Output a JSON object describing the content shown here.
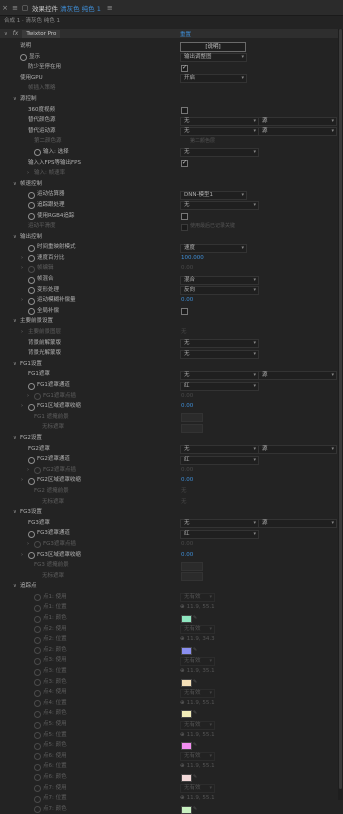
{
  "header": {
    "menu_icon": "hamburger-icon",
    "lock_icon": "lock-icon",
    "title_prefix": "效果控件",
    "title_accent": "清灰色 纯色 1",
    "title_suffix": "≡",
    "panel_menu": "≡"
  },
  "breadcrumb": "合成 1 · 清灰色 纯色 1",
  "effect": {
    "fx_label": "fx",
    "name": "Twixtor Pro",
    "reset": "重置"
  },
  "rows": [
    {
      "indent": 1,
      "label": "说明",
      "control": "button",
      "value": "[说明]"
    },
    {
      "indent": 1,
      "label": "显示",
      "control": "dropdown",
      "value": "输出调整图",
      "stopwatch": true,
      "dd_width": 62
    },
    {
      "indent": 2,
      "label": "防少至停在用",
      "control": "checkbox",
      "checked": true
    },
    {
      "indent": 1,
      "label": "使用GPU",
      "control": "dropdown",
      "value": "开启",
      "dd_width": 62
    },
    {
      "indent": 2,
      "label": "帧插入策略",
      "control": "none",
      "dim": true
    },
    {
      "indent": 1,
      "label": "源控制",
      "control": "none",
      "twirl": "open"
    },
    {
      "indent": 2,
      "label": "360度视频",
      "control": "checkbox",
      "checked": false
    },
    {
      "indent": 2,
      "label": "替代颜色源",
      "control": "dropdown2",
      "value": "无",
      "value2": "源",
      "dd_width": 74
    },
    {
      "indent": 2,
      "label": "替代运动源",
      "control": "dropdown2",
      "value": "无",
      "value2": "源",
      "dd_width": 74
    },
    {
      "indent": 3,
      "label": "第二颜色源",
      "control": "none",
      "dim": true,
      "right_label": "第二颜色层"
    },
    {
      "indent": 3,
      "label": "输入: 选择",
      "control": "dropdown",
      "value": "无",
      "stopwatch": true,
      "dd_width": 74
    },
    {
      "indent": 2,
      "label": "输入入FPS等输出FPS",
      "control": "checkbox",
      "checked": true
    },
    {
      "indent": 3,
      "label": "输入: 帧速率",
      "control": "none",
      "dim": true,
      "twirl": "closed"
    },
    {
      "indent": 1,
      "label": "帧速控制",
      "control": "none",
      "twirl": "open"
    },
    {
      "indent": 2,
      "label": "运动估算器",
      "control": "dropdown",
      "value": "DNN-模型1",
      "stopwatch": true,
      "dd_width": 62
    },
    {
      "indent": 2,
      "label": "追踪跟处理",
      "control": "dropdown",
      "value": "无",
      "stopwatch": true,
      "dd_width": 74
    },
    {
      "indent": 2,
      "label": "使用RGB4追踪",
      "control": "checkbox",
      "checked": false,
      "stopwatch": true
    },
    {
      "indent": 2,
      "label": "运动平滑度",
      "control": "checkbox_label",
      "checked": false,
      "dim": true,
      "right_label": "使用最后已记录关键"
    },
    {
      "indent": 1,
      "label": "输出控制",
      "control": "none",
      "twirl": "open"
    },
    {
      "indent": 2,
      "label": "时间重映射模式",
      "control": "dropdown",
      "value": "速度",
      "stopwatch": true,
      "dd_width": 62
    },
    {
      "indent": 2,
      "label": "速度百分比",
      "control": "value",
      "value": "100.000",
      "stopwatch": true,
      "twirl": "closed"
    },
    {
      "indent": 2,
      "label": "帧编辑",
      "control": "value",
      "value": "0.00",
      "stopwatch": true,
      "twirl": "closed",
      "dim": true
    },
    {
      "indent": 2,
      "label": "帧混合",
      "control": "dropdown",
      "value": "混合",
      "stopwatch": true,
      "dd_width": 74
    },
    {
      "indent": 2,
      "label": "变形处理",
      "control": "dropdown",
      "value": "反向",
      "stopwatch": true,
      "dd_width": 74
    },
    {
      "indent": 2,
      "label": "运动模糊补偿量",
      "control": "value",
      "value": "0.00",
      "stopwatch": true,
      "twirl": "closed"
    },
    {
      "indent": 2,
      "label": "全局补偿",
      "control": "checkbox",
      "checked": false,
      "stopwatch": true
    },
    {
      "indent": 1,
      "label": "主要前景设置",
      "control": "none",
      "twirl": "open"
    },
    {
      "indent": 2,
      "label": "主要前景图层",
      "control": "value_dim",
      "value": "无",
      "twirl": "closed",
      "dim": true
    },
    {
      "indent": 2,
      "label": "背景前解蒙版",
      "control": "dropdown",
      "value": "无",
      "dd_width": 74
    },
    {
      "indent": 2,
      "label": "背景光解蒙版",
      "control": "dropdown",
      "value": "无",
      "dd_width": 74
    },
    {
      "indent": 1,
      "label": "FG1设置",
      "control": "none",
      "twirl": "open"
    },
    {
      "indent": 2,
      "label": "FG1遮罩",
      "control": "dropdown2",
      "value": "无",
      "value2": "源",
      "dd_width": 74
    },
    {
      "indent": 2,
      "label": "FG1遮罩通道",
      "control": "dropdown",
      "value": "红",
      "stopwatch": true,
      "dd_width": 74
    },
    {
      "indent": 3,
      "label": "FG1遮罩点插",
      "control": "value_dim",
      "value": "0.00",
      "twirl": "closed",
      "dim": true,
      "stopwatch": true
    },
    {
      "indent": 2,
      "label": "FG1区域遮罩收缩",
      "control": "value",
      "value": "0.00",
      "stopwatch": true,
      "twirl": "closed"
    },
    {
      "indent": 3,
      "label": "FG1 遮掩前景",
      "control": "box",
      "dim": true
    },
    {
      "indent": 4,
      "label": "无标遮罩",
      "control": "box",
      "dim": true
    },
    {
      "indent": 1,
      "label": "FG2设置",
      "control": "none",
      "twirl": "open"
    },
    {
      "indent": 2,
      "label": "FG2遮罩",
      "control": "dropdown2",
      "value": "无",
      "value2": "源",
      "dd_width": 74
    },
    {
      "indent": 2,
      "label": "FG2遮罩通道",
      "control": "dropdown",
      "value": "红",
      "stopwatch": true,
      "dd_width": 74
    },
    {
      "indent": 3,
      "label": "FG2遮罩点插",
      "control": "value_dim",
      "value": "0.00",
      "twirl": "closed",
      "dim": true,
      "stopwatch": true
    },
    {
      "indent": 2,
      "label": "FG2区域遮罩收缩",
      "control": "value",
      "value": "0.00",
      "stopwatch": true,
      "twirl": "closed"
    },
    {
      "indent": 3,
      "label": "FG2 遮掩前景",
      "control": "value_dim",
      "value": "无",
      "dim": true
    },
    {
      "indent": 4,
      "label": "无标遮罩",
      "control": "value_dim",
      "value": "无",
      "dim": true
    },
    {
      "indent": 1,
      "label": "FG3设置",
      "control": "none",
      "twirl": "open"
    },
    {
      "indent": 2,
      "label": "FG3遮罩",
      "control": "dropdown2",
      "value": "无",
      "value2": "源",
      "dd_width": 74
    },
    {
      "indent": 2,
      "label": "FG3遮罩通道",
      "control": "dropdown",
      "value": "红",
      "stopwatch": true,
      "dd_width": 74
    },
    {
      "indent": 3,
      "label": "FG3遮罩点插",
      "control": "value_dim",
      "value": "0.00",
      "twirl": "closed",
      "dim": true,
      "stopwatch": true
    },
    {
      "indent": 2,
      "label": "FG3区域遮罩收缩",
      "control": "value",
      "value": "0.00",
      "stopwatch": true,
      "twirl": "closed"
    },
    {
      "indent": 3,
      "label": "FG3 遮掩前景",
      "control": "box",
      "dim": true
    },
    {
      "indent": 4,
      "label": "无标遮罩",
      "control": "box",
      "dim": true
    },
    {
      "indent": 1,
      "label": "追踪点",
      "control": "none",
      "twirl": "open"
    },
    {
      "indent": 3,
      "label": "点1: 使用",
      "control": "dropdown",
      "value": "无有效",
      "dim": true,
      "stopwatch": true,
      "dd_width": 30
    },
    {
      "indent": 3,
      "label": "点1: 位置",
      "control": "point",
      "value": "11.9, 55.1",
      "dim": true,
      "stopwatch": true
    },
    {
      "indent": 3,
      "label": "点1: 颜色",
      "control": "swatch",
      "color": "#8fe6c0",
      "dim": true,
      "stopwatch": true
    },
    {
      "indent": 3,
      "label": "点2: 使用",
      "control": "dropdown",
      "value": "无有效",
      "dim": true,
      "stopwatch": true,
      "dd_width": 30
    },
    {
      "indent": 3,
      "label": "点2: 位置",
      "control": "point",
      "value": "11.9, 34.3",
      "dim": true,
      "stopwatch": true
    },
    {
      "indent": 3,
      "label": "点2: 颜色",
      "control": "swatch",
      "color": "#8a8ff0",
      "dim": true,
      "stopwatch": true
    },
    {
      "indent": 3,
      "label": "点3: 使用",
      "control": "dropdown",
      "value": "无有效",
      "dim": true,
      "stopwatch": true,
      "dd_width": 30
    },
    {
      "indent": 3,
      "label": "点3: 位置",
      "control": "point",
      "value": "11.9, 35.1",
      "dim": true,
      "stopwatch": true
    },
    {
      "indent": 3,
      "label": "点3: 颜色",
      "control": "swatch",
      "color": "#f5e0b8",
      "dim": true,
      "stopwatch": true
    },
    {
      "indent": 3,
      "label": "点4: 使用",
      "control": "dropdown",
      "value": "无有效",
      "dim": true,
      "stopwatch": true,
      "dd_width": 30
    },
    {
      "indent": 3,
      "label": "点4: 位置",
      "control": "point",
      "value": "11.9, 55.1",
      "dim": true,
      "stopwatch": true
    },
    {
      "indent": 3,
      "label": "点4: 颜色",
      "control": "swatch",
      "color": "#f2ecb8",
      "dim": true,
      "stopwatch": true
    },
    {
      "indent": 3,
      "label": "点5: 使用",
      "control": "dropdown",
      "value": "无有效",
      "dim": true,
      "stopwatch": true,
      "dd_width": 30
    },
    {
      "indent": 3,
      "label": "点5: 位置",
      "control": "point",
      "value": "11.9, 55.1",
      "dim": true,
      "stopwatch": true
    },
    {
      "indent": 3,
      "label": "点5: 颜色",
      "control": "swatch",
      "color": "#f28ef0",
      "dim": true,
      "stopwatch": true
    },
    {
      "indent": 3,
      "label": "点6: 使用",
      "control": "dropdown",
      "value": "无有效",
      "dim": true,
      "stopwatch": true,
      "dd_width": 30
    },
    {
      "indent": 3,
      "label": "点6: 位置",
      "control": "point",
      "value": "11.9, 55.1",
      "dim": true,
      "stopwatch": true
    },
    {
      "indent": 3,
      "label": "点6: 颜色",
      "control": "swatch",
      "color": "#f2d8d8",
      "dim": true,
      "stopwatch": true
    },
    {
      "indent": 3,
      "label": "点7: 使用",
      "control": "dropdown",
      "value": "无有效",
      "dim": true,
      "stopwatch": true,
      "dd_width": 30
    },
    {
      "indent": 3,
      "label": "点7: 位置",
      "control": "point",
      "value": "11.9, 55.1",
      "dim": true,
      "stopwatch": true
    },
    {
      "indent": 3,
      "label": "点7: 颜色",
      "control": "swatch",
      "color": "#c8f0c0",
      "dim": true,
      "stopwatch": true
    }
  ]
}
